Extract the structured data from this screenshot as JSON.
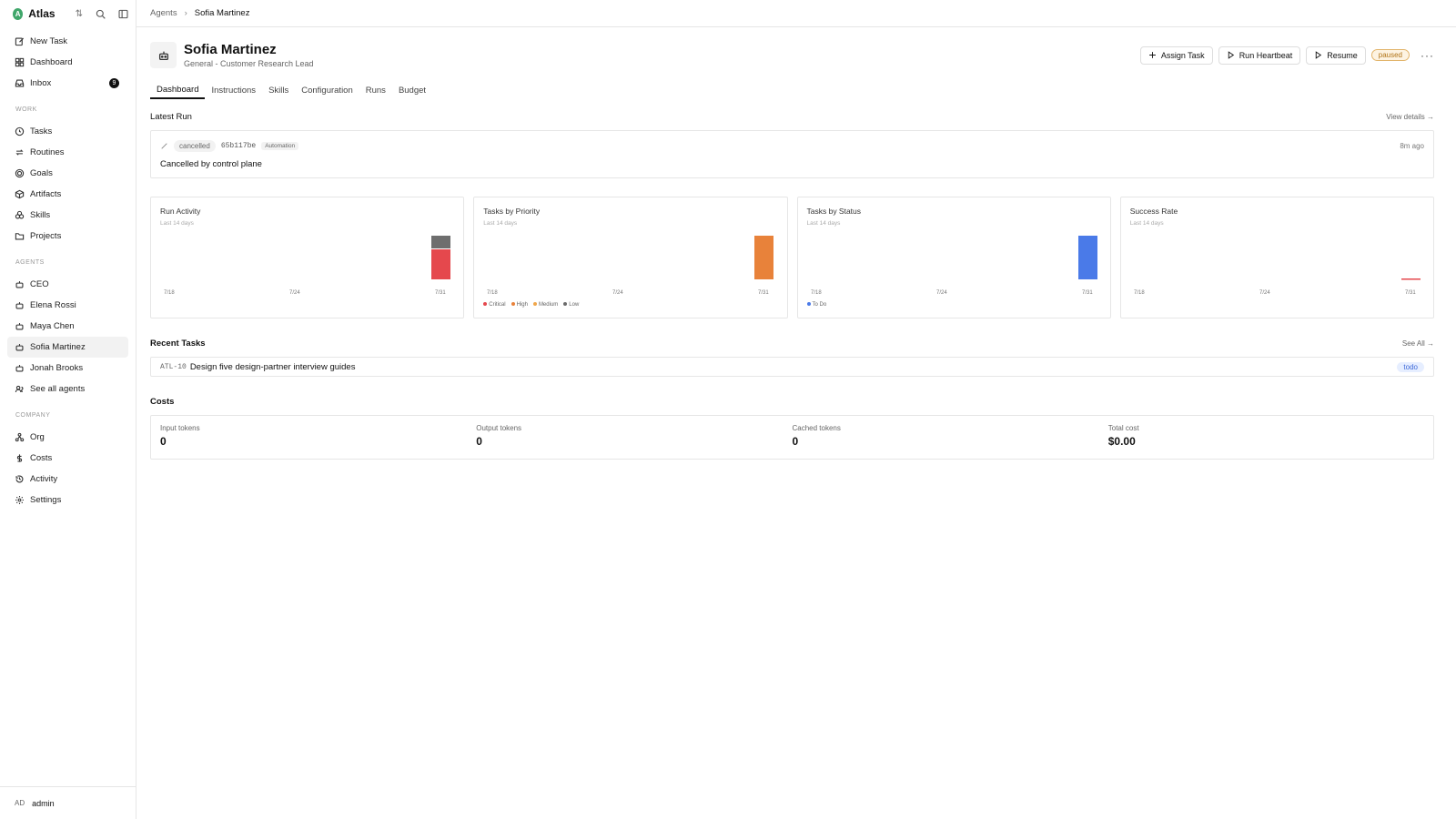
{
  "workspace": {
    "name": "Atlas",
    "logo_letter": "A"
  },
  "sidebar": {
    "top": [
      {
        "label": "New Task",
        "icon": "pencil-square-icon"
      },
      {
        "label": "Dashboard",
        "icon": "dashboard-icon"
      },
      {
        "label": "Inbox",
        "icon": "inbox-icon",
        "badge": "9"
      }
    ],
    "work_heading": "WORK",
    "work": [
      {
        "label": "Tasks"
      },
      {
        "label": "Routines"
      },
      {
        "label": "Goals"
      },
      {
        "label": "Artifacts"
      },
      {
        "label": "Skills"
      },
      {
        "label": "Projects"
      }
    ],
    "agents_heading": "AGENTS",
    "agents": [
      {
        "label": "CEO"
      },
      {
        "label": "Elena Rossi"
      },
      {
        "label": "Maya Chen"
      },
      {
        "label": "Sofia Martinez"
      },
      {
        "label": "Jonah Brooks"
      },
      {
        "label": "See all agents"
      }
    ],
    "company_heading": "COMPANY",
    "company": [
      {
        "label": "Org"
      },
      {
        "label": "Costs"
      },
      {
        "label": "Activity"
      },
      {
        "label": "Settings"
      }
    ],
    "user": {
      "initials": "AD",
      "name": "admin"
    }
  },
  "breadcrumb": {
    "parent": "Agents",
    "current": "Sofia Martinez"
  },
  "agent": {
    "name": "Sofia Martinez",
    "role": "General - Customer Research Lead"
  },
  "actions": {
    "assign": "Assign Task",
    "heartbeat": "Run Heartbeat",
    "resume": "Resume",
    "status": "paused",
    "more": "···"
  },
  "tabs": [
    "Dashboard",
    "Instructions",
    "Skills",
    "Configuration",
    "Runs",
    "Budget"
  ],
  "latest_run": {
    "heading": "Latest Run",
    "link": "View details →",
    "status": "cancelled",
    "id": "65b117be",
    "tag": "Automation",
    "time": "8m ago",
    "message": "Cancelled by control plane"
  },
  "charts": [
    {
      "title": "Run Activity",
      "sub": "Last 14 days",
      "ticks": [
        "7/18",
        "7/24",
        "7/31"
      ]
    },
    {
      "title": "Tasks by Priority",
      "sub": "Last 14 days",
      "ticks": [
        "7/18",
        "7/24",
        "7/31"
      ],
      "legend": [
        "Critical",
        "High",
        "Medium",
        "Low"
      ]
    },
    {
      "title": "Tasks by Status",
      "sub": "Last 14 days",
      "ticks": [
        "7/18",
        "7/24",
        "7/31"
      ],
      "legend": [
        "To Do"
      ]
    },
    {
      "title": "Success Rate",
      "sub": "Last 14 days",
      "ticks": [
        "7/18",
        "7/24",
        "7/31"
      ]
    }
  ],
  "colors": {
    "critical": "#e5484d",
    "high": "#e8823a",
    "medium": "#f0a64a",
    "low": "#6b6b6b",
    "todo": "#4a7ae8",
    "grey": "#6e6e6e"
  },
  "recent_tasks": {
    "heading": "Recent Tasks",
    "link": "See All →",
    "items": [
      {
        "id": "ATL-10",
        "title": "Design five design-partner interview guides",
        "status": "todo"
      }
    ]
  },
  "costs": {
    "heading": "Costs",
    "items": [
      {
        "label": "Input tokens",
        "value": "0"
      },
      {
        "label": "Output tokens",
        "value": "0"
      },
      {
        "label": "Cached tokens",
        "value": "0"
      },
      {
        "label": "Total cost",
        "value": "$0.00"
      }
    ]
  }
}
